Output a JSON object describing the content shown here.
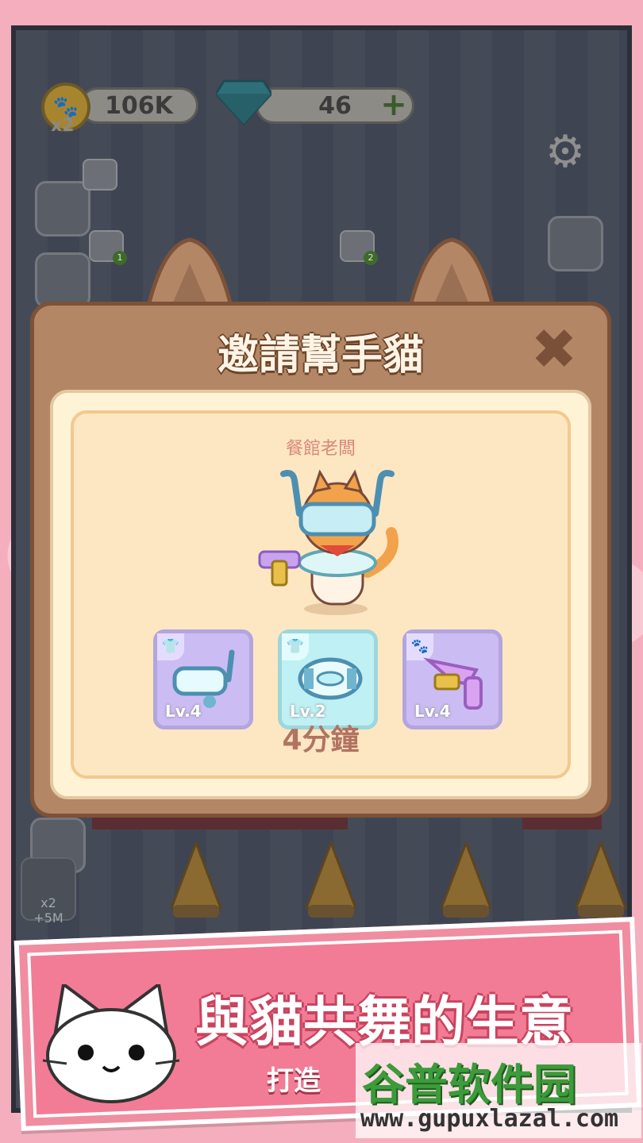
{
  "hud": {
    "coins": "106K",
    "coin_multiplier": "x2",
    "gems": "46",
    "add_gems": "+",
    "settings": "⚙"
  },
  "side": {
    "badge_a": "1",
    "badge_b": "2",
    "boost_label": "x2",
    "boost_value": "+5M"
  },
  "dialog": {
    "title": "邀請幫手貓",
    "close": "✖",
    "role": "餐館老闆",
    "items": [
      {
        "level": "Lv.4",
        "icon": "shirt-icon",
        "item": "snorkel-mask"
      },
      {
        "level": "Lv.2",
        "icon": "shirt-icon",
        "item": "swim-ring"
      },
      {
        "level": "Lv.4",
        "icon": "paw-icon",
        "item": "water-gun"
      }
    ],
    "duration": "4分鐘"
  },
  "banner": {
    "title": "與貓共舞的生意",
    "subtitle": "打造",
    "watermark_cn": "谷普软件园",
    "watermark_url": "www.gupuxlazal.com"
  },
  "colors": {
    "modal_brown": "#b38666",
    "panel_cream": "#fde7c3",
    "item_purple": "#cbbdf3",
    "item_cyan": "#bff0f4",
    "banner_pink": "#f27c95"
  }
}
